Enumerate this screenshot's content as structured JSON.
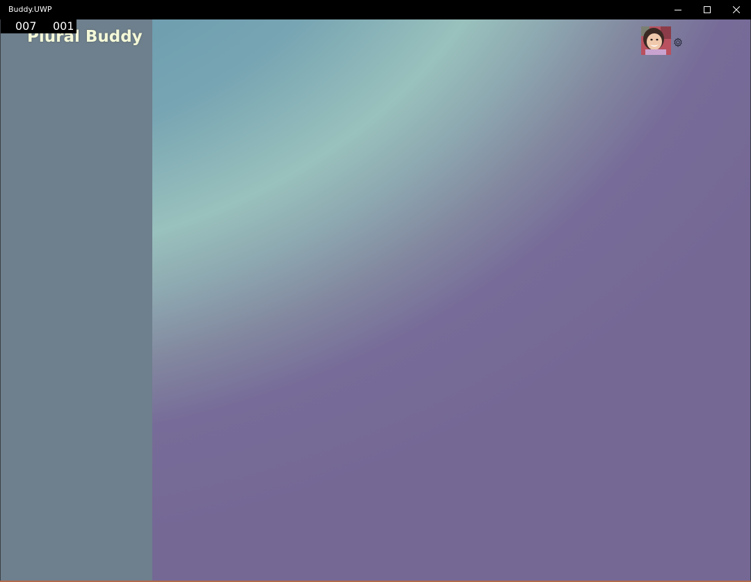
{
  "window": {
    "title": "Buddy.UWP",
    "minimize_icon": "minimize-icon",
    "maximize_icon": "maximize-icon",
    "close_icon": "close-icon"
  },
  "app": {
    "name": "Plural Buddy"
  },
  "overlay": {
    "counter_left": "007",
    "counter_right": "001"
  },
  "header": {
    "avatar_icon": "user-avatar",
    "settings_icon": "gear-icon"
  },
  "colors": {
    "titlebar": "#000000",
    "sidebar": "#6e7f8d",
    "app_name_text": "#f4f8d8",
    "gradient_blue": "#6f9fb0",
    "gradient_mint": "#99c1bd",
    "gradient_purple": "#756895"
  }
}
